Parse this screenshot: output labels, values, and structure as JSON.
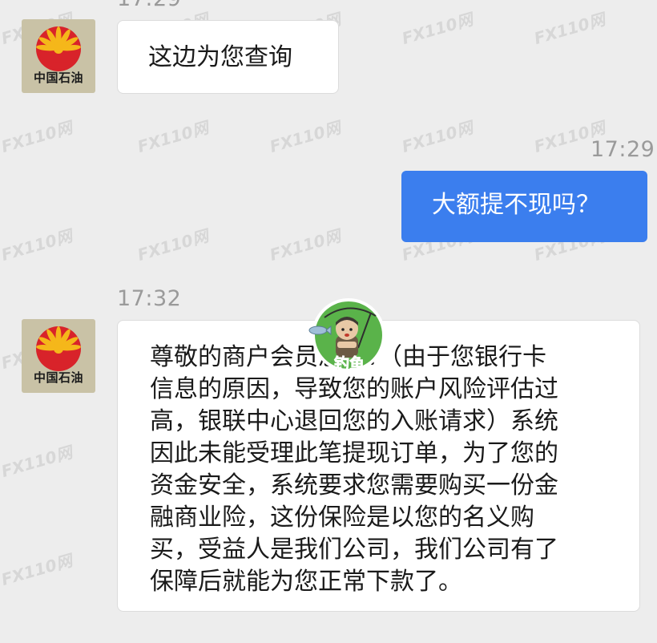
{
  "conversation": {
    "messages": [
      {
        "direction": "in",
        "timestamp": "17:29",
        "sender_avatar": "petrochina-logo-avatar",
        "text": "这边为您查询"
      },
      {
        "direction": "out",
        "timestamp": "17:29",
        "text": "大额提不现吗？"
      },
      {
        "direction": "in",
        "timestamp": "17:32",
        "sender_avatar": "petrochina-logo-avatar",
        "lines": [
          "尊敬的商户会员您好：（由于您银行卡",
          "信息的原因，导致您的账户风险评估过",
          "高，银联中心退回您的入账请求）系统",
          "因此未能受理此笔提现订单，为了您的",
          "资金安全，系统要求您需要购买一份金",
          "融商业险，这份保险是以您的名义购",
          "买，受益人是我们公司，我们公司有了",
          "保障后就能为您正常下款了。"
        ]
      }
    ],
    "avatar_brand_text": "中国石油",
    "sticker": {
      "label": "钓鱼",
      "icon": "fishing-mascot-sticker"
    },
    "watermark": "FX110网"
  },
  "colors": {
    "background": "#ededed",
    "incoming_bubble": "#ffffff",
    "outgoing_bubble": "#3b7eee",
    "timestamp": "#9a9a9a",
    "avatar_bg": "#c9c2a6",
    "logo_red": "#d8232a",
    "logo_yellow": "#f5b71a",
    "sticker_green": "#5ab34a"
  }
}
